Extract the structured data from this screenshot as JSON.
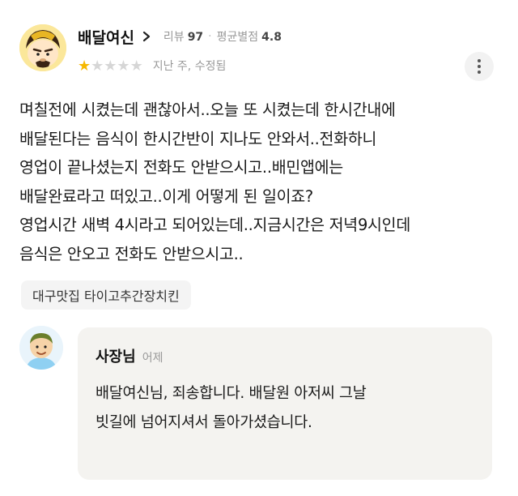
{
  "reviewer": {
    "name": "배달여신",
    "review_count_label": "리뷰",
    "review_count": "97",
    "avg_rating_label": "평균별점",
    "avg_rating": "4.8",
    "rating_stars": 1,
    "rating_max": 5,
    "edited_text": "지난 주, 수정됨"
  },
  "review": {
    "lines": [
      "며칠전에 시켰는데 괜찮아서..오늘 또 시켰는데 한시간내에",
      "배달된다는 음식이 한시간반이 지나도 안와서..전화하니",
      "영업이 끝나셨는지 전화도 안받으시고..배민앱에는",
      "배달완료라고 떠있고..이게 어떻게 된 일이죠?",
      "영업시간 새벽 4시라고 되어있는데..지금시간은 저녁9시인데",
      "음식은 안오고 전화도 안받으시고.."
    ]
  },
  "store": {
    "tag": "대구맛집 타이고추간장치킨"
  },
  "owner_reply": {
    "name": "사장님",
    "time": "어제",
    "lines": [
      "배달여신님, 죄송합니다. 배달원 아저씨 그날",
      "빗길에  넘어지셔서 돌아가셨습니다."
    ]
  },
  "icons": {
    "chevron": "chevron-right-icon",
    "more": "more-vertical-icon",
    "star": "star-icon"
  },
  "colors": {
    "star_filled": "#f6b800",
    "star_empty": "#d6d6d6",
    "reply_bg": "#f4f3f0"
  }
}
